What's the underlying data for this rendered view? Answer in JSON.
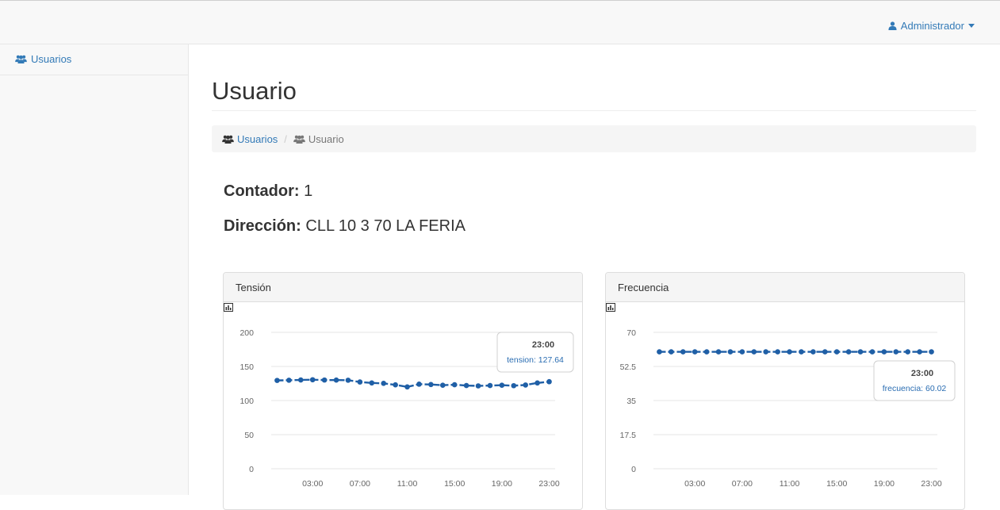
{
  "header": {
    "user_label": "Administrador",
    "user_icon": "user-icon",
    "caret_icon": "caret-down-icon"
  },
  "sidebar": {
    "items": [
      {
        "label": "Usuarios",
        "icon": "users-icon"
      }
    ]
  },
  "page": {
    "title": "Usuario"
  },
  "breadcrumb": {
    "items": [
      {
        "label": "Usuarios",
        "icon": "users-icon"
      },
      {
        "label": "Usuario",
        "icon": "users-icon"
      }
    ],
    "separator": "/"
  },
  "details": {
    "contador_label": "Contador:",
    "contador_value": "1",
    "direccion_label": "Dirección:",
    "direccion_value": "CLL 10 3 70 LA FERIA"
  },
  "colors": {
    "accent": "#337ab7",
    "series": "#1f5fa6"
  },
  "panels": {
    "tension_title": "Tensión",
    "frecuencia_title": "Frecuencia",
    "icon": "bar-chart-icon"
  },
  "chart_data": [
    {
      "type": "line",
      "title": "Tensión",
      "xlabel": "",
      "ylabel": "",
      "x": [
        "00:00",
        "01:00",
        "02:00",
        "03:00",
        "04:00",
        "05:00",
        "06:00",
        "07:00",
        "08:00",
        "09:00",
        "10:00",
        "11:00",
        "12:00",
        "13:00",
        "14:00",
        "15:00",
        "16:00",
        "17:00",
        "18:00",
        "19:00",
        "20:00",
        "21:00",
        "22:00",
        "23:00"
      ],
      "xticks": [
        "03:00",
        "07:00",
        "11:00",
        "15:00",
        "19:00",
        "23:00"
      ],
      "yticks": [
        0,
        50,
        100,
        150,
        200
      ],
      "ylim": [
        0,
        200
      ],
      "grid": true,
      "series": [
        {
          "name": "tension",
          "values": [
            129.5,
            129.8,
            130.2,
            130.5,
            130.1,
            130.0,
            129.8,
            127.2,
            125.8,
            125.2,
            123.0,
            120.0,
            124.0,
            123.5,
            122.5,
            123.2,
            122.0,
            121.5,
            122.0,
            122.5,
            121.8,
            122.8,
            125.8,
            127.64
          ]
        }
      ],
      "tooltip": {
        "title": "23:00",
        "label": "tension: 127.64"
      }
    },
    {
      "type": "line",
      "title": "Frecuencia",
      "xlabel": "",
      "ylabel": "",
      "x": [
        "00:00",
        "01:00",
        "02:00",
        "03:00",
        "04:00",
        "05:00",
        "06:00",
        "07:00",
        "08:00",
        "09:00",
        "10:00",
        "11:00",
        "12:00",
        "13:00",
        "14:00",
        "15:00",
        "16:00",
        "17:00",
        "18:00",
        "19:00",
        "20:00",
        "21:00",
        "22:00",
        "23:00"
      ],
      "xticks": [
        "03:00",
        "07:00",
        "11:00",
        "15:00",
        "19:00",
        "23:00"
      ],
      "yticks": [
        0,
        17.5,
        35,
        52.5,
        70
      ],
      "ylim": [
        0,
        70
      ],
      "grid": true,
      "series": [
        {
          "name": "frecuencia",
          "values": [
            60.0,
            60.01,
            60.0,
            60.02,
            59.99,
            60.0,
            60.01,
            60.0,
            60.0,
            60.02,
            60.0,
            60.01,
            60.0,
            59.99,
            60.0,
            60.01,
            60.0,
            60.02,
            60.0,
            60.0,
            60.01,
            60.0,
            60.01,
            60.02
          ]
        }
      ],
      "tooltip": {
        "title": "23:00",
        "label": "frecuencia: 60.02"
      }
    }
  ]
}
